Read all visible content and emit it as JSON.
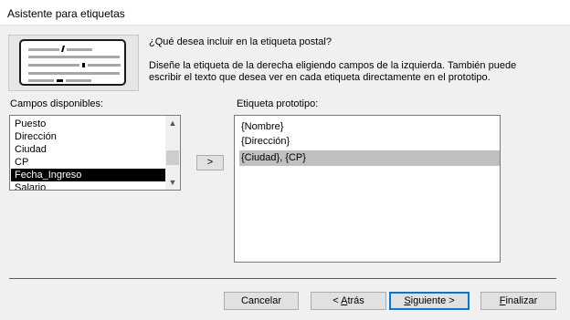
{
  "window": {
    "title": "Asistente para etiquetas"
  },
  "prompt": {
    "question": "¿Qué desea incluir en la etiqueta postal?",
    "description": "Diseñe la etiqueta de la derecha eligiendo campos de la izquierda. También puede escribir el texto que desea ver en cada etiqueta directamente en el prototipo."
  },
  "available": {
    "label": "Campos disponibles:",
    "items": [
      "Puesto",
      "Dirección",
      "Ciudad",
      "CP",
      "Fecha_Ingreso",
      "Salario"
    ],
    "selected": "Fecha_Ingreso"
  },
  "add_button": {
    "label": ">"
  },
  "prototype": {
    "label": "Etiqueta prototipo:",
    "lines": [
      "{Nombre}",
      "{Dirección}",
      "{Ciudad}, {CP}"
    ]
  },
  "buttons": {
    "cancel": "Cancelar",
    "back_prefix": "< ",
    "back_accel": "A",
    "back_rest": "trás",
    "next_prefix": "",
    "next_accel": "S",
    "next_rest": "iguiente >",
    "finish_accel": "F",
    "finish_rest": "inalizar"
  },
  "icons": {
    "scroll_up": "scroll-up-arrow-icon",
    "scroll_down": "scroll-down-arrow-icon",
    "illustration": "mailing-label-illustration-icon"
  }
}
